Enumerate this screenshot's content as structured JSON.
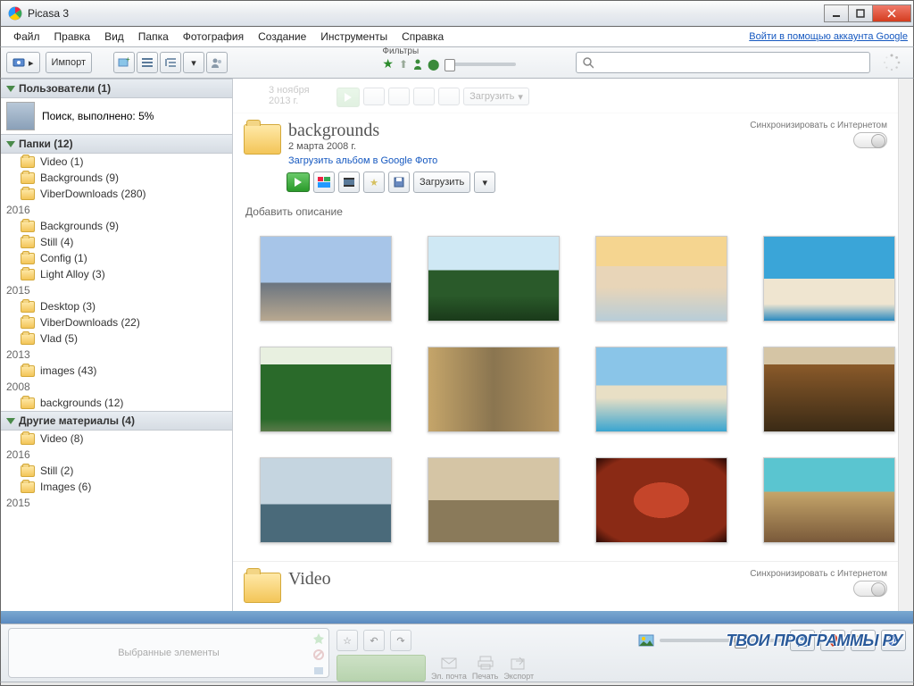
{
  "window": {
    "title": "Picasa 3"
  },
  "menu": [
    "Файл",
    "Правка",
    "Вид",
    "Папка",
    "Фотография",
    "Создание",
    "Инструменты",
    "Справка"
  ],
  "signin_link": "Войти в помощью аккаунта Google",
  "toolbar": {
    "import": "Импорт",
    "filters_label": "Фильтры"
  },
  "search": {
    "placeholder": ""
  },
  "sidebar": {
    "users_header": "Пользователи (1)",
    "search_status": "Поиск, выполнено: 5%",
    "folders_header": "Папки (12)",
    "root_items": [
      {
        "label": "Video (1)"
      },
      {
        "label": "Backgrounds (9)"
      },
      {
        "label": "ViberDownloads (280)"
      }
    ],
    "years": [
      {
        "year": "2016",
        "items": [
          {
            "label": "Backgrounds (9)"
          },
          {
            "label": "Still (4)"
          },
          {
            "label": "Config (1)"
          },
          {
            "label": "Light Alloy (3)"
          }
        ]
      },
      {
        "year": "2015",
        "items": [
          {
            "label": "Desktop (3)"
          },
          {
            "label": "ViberDownloads (22)"
          },
          {
            "label": "Vlad (5)"
          }
        ]
      },
      {
        "year": "2013",
        "items": [
          {
            "label": "images (43)"
          }
        ]
      },
      {
        "year": "2008",
        "items": [
          {
            "label": "backgrounds (12)"
          }
        ]
      }
    ],
    "other_header": "Другие материалы (4)",
    "other_root": [
      {
        "label": "Video (8)"
      }
    ],
    "other_years": [
      {
        "year": "2016",
        "items": [
          {
            "label": "Still (2)"
          },
          {
            "label": "Images (6)"
          }
        ]
      },
      {
        "year": "2015",
        "items": []
      }
    ]
  },
  "prev_album": {
    "date_hint": "3 ноября 2013 г.",
    "upload": "Загрузить"
  },
  "album": {
    "title": "backgrounds",
    "date": "2 марта 2008 г.",
    "upload_link": "Загрузить альбом в Google Фото",
    "upload_btn": "Загрузить",
    "sync_label": "Синхронизировать с Интернетом",
    "description_placeholder": "Добавить описание"
  },
  "next_album": {
    "title": "Video",
    "sync_label": "Синхронизировать с Интернетом"
  },
  "bottom": {
    "tray_placeholder": "Выбранные элементы",
    "actions": {
      "email": "Эл. почта",
      "print": "Печать",
      "export": "Экспорт"
    }
  },
  "watermark": "ТВОИ ПРОГРАММЫ РУ"
}
